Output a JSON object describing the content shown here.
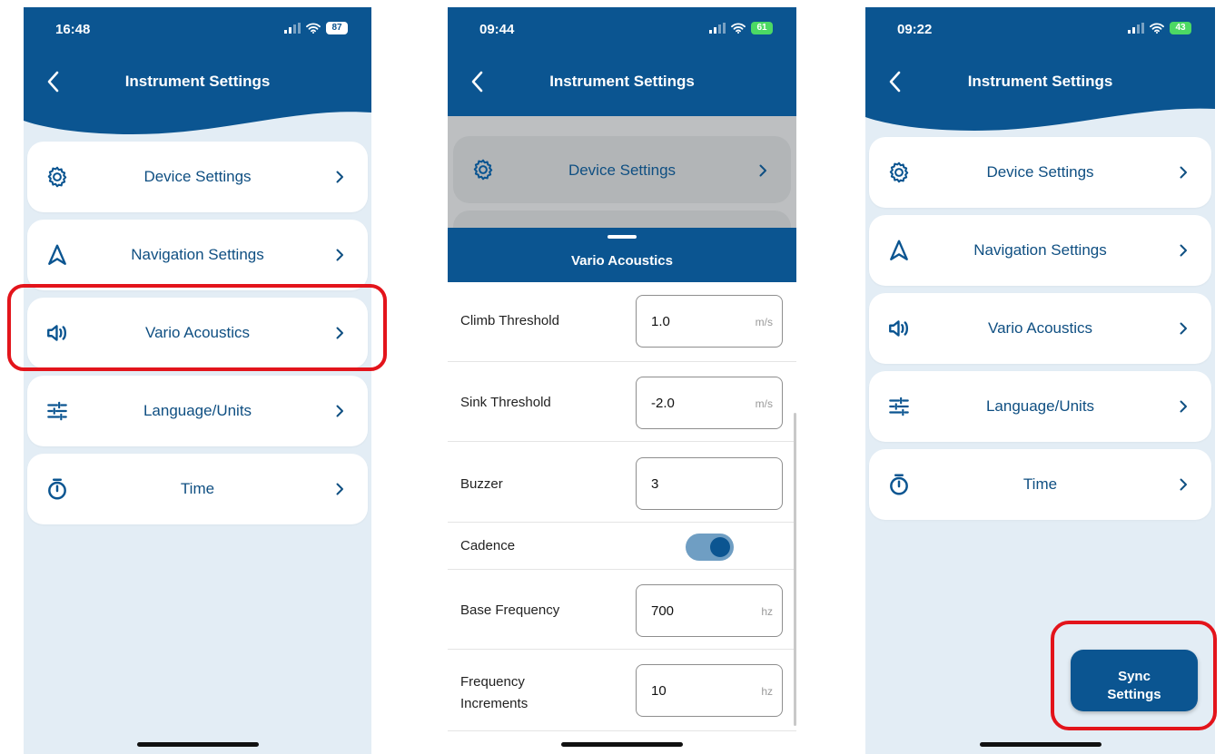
{
  "colors": {
    "brand": "#0b5591",
    "highlight": "#e3141b",
    "background": "#e3edf5"
  },
  "screen1": {
    "status": {
      "time": "16:48",
      "battery": "87"
    },
    "title": "Instrument Settings",
    "menu": [
      {
        "label": "Device Settings",
        "icon": "gear-icon"
      },
      {
        "label": "Navigation Settings",
        "icon": "navigation-icon"
      },
      {
        "label": "Vario Acoustics",
        "icon": "speaker-icon"
      },
      {
        "label": "Language/Units",
        "icon": "sliders-icon"
      },
      {
        "label": "Time",
        "icon": "stopwatch-icon"
      }
    ]
  },
  "screen2": {
    "status": {
      "time": "09:44",
      "battery": "61"
    },
    "title": "Instrument Settings",
    "background_item": {
      "label": "Device Settings",
      "icon": "gear-icon"
    },
    "sheet_title": "Vario Acoustics",
    "rows": [
      {
        "label": "Climb Threshold",
        "value": "1.0",
        "unit": "m/s"
      },
      {
        "label": "Sink Threshold",
        "value": "-2.0",
        "unit": "m/s"
      },
      {
        "label": "Buzzer",
        "value": "3",
        "unit": ""
      },
      {
        "label": "Cadence",
        "toggle": true
      },
      {
        "label": "Base Frequency",
        "value": "700",
        "unit": "hz"
      },
      {
        "label_line1": "Frequency",
        "label_line2": "Increments",
        "value": "10",
        "unit": "hz"
      }
    ]
  },
  "screen3": {
    "status": {
      "time": "09:22",
      "battery": "43"
    },
    "title": "Instrument Settings",
    "menu": [
      {
        "label": "Device Settings",
        "icon": "gear-icon"
      },
      {
        "label": "Navigation Settings",
        "icon": "navigation-icon"
      },
      {
        "label": "Vario Acoustics",
        "icon": "speaker-icon"
      },
      {
        "label": "Language/Units",
        "icon": "sliders-icon"
      },
      {
        "label": "Time",
        "icon": "stopwatch-icon"
      }
    ],
    "sync_button": {
      "line1": "Sync",
      "line2": "Settings"
    }
  }
}
